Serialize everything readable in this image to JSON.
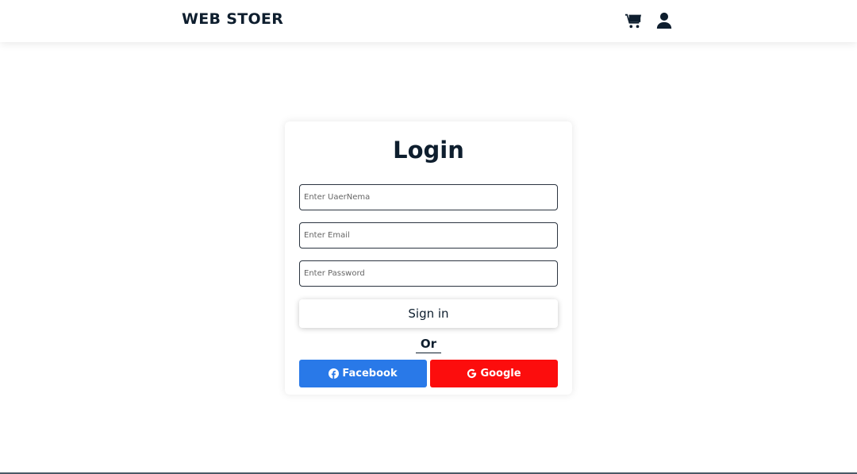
{
  "header": {
    "brand": "WEB STOER",
    "icons": [
      "cart-icon",
      "user-icon"
    ]
  },
  "login": {
    "title": "Login",
    "username_placeholder": "Enter UaerNema",
    "email_placeholder": "Enter Email",
    "password_placeholder": "Enter Password",
    "signin_label": "Sign in",
    "or_label": "Or",
    "facebook_label": "Facebook",
    "google_label": "Google"
  },
  "colors": {
    "text_dark": "#0e1e2e",
    "facebook": "#2979e8",
    "google": "#fc0d0d"
  }
}
